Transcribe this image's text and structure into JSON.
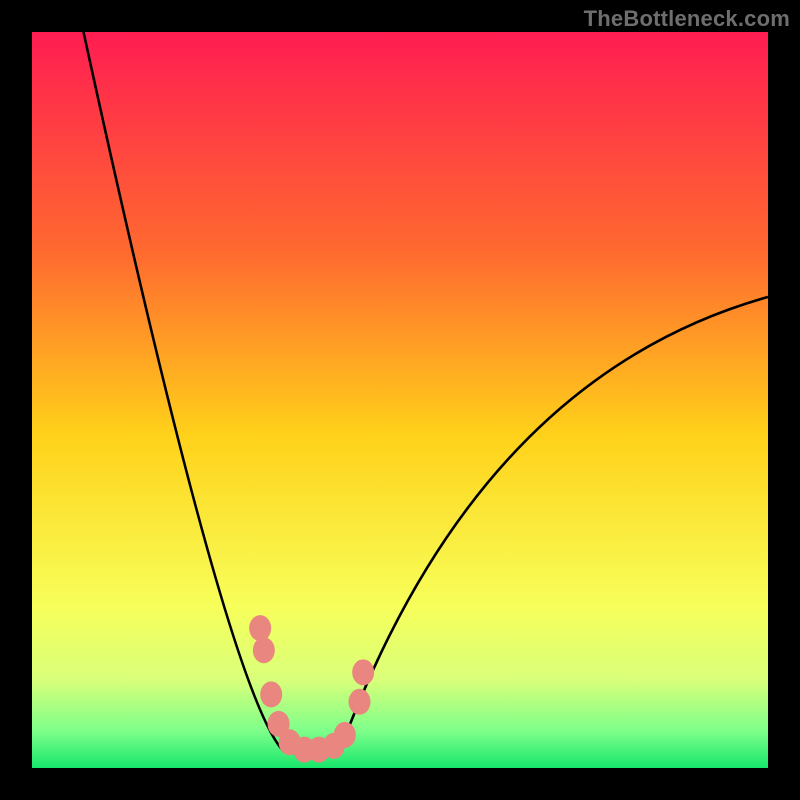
{
  "watermark": "TheBottleneck.com",
  "chart_data": {
    "type": "line",
    "title": "",
    "xlabel": "",
    "ylabel": "",
    "xlim": [
      0,
      100
    ],
    "ylim": [
      0,
      100
    ],
    "grid": false,
    "legend": false,
    "gradient": {
      "stops": [
        {
          "offset": 0.0,
          "color": "#ff1d52"
        },
        {
          "offset": 0.3,
          "color": "#ff6a2f"
        },
        {
          "offset": 0.55,
          "color": "#ffd21a"
        },
        {
          "offset": 0.78,
          "color": "#f7ff5a"
        },
        {
          "offset": 0.88,
          "color": "#d9ff7a"
        },
        {
          "offset": 0.95,
          "color": "#7dff8a"
        },
        {
          "offset": 1.0,
          "color": "#17e66c"
        }
      ]
    },
    "green_band": {
      "y_top": 93,
      "y_bottom": 100
    },
    "curve": {
      "type": "v-shape",
      "vertex_x": 38,
      "vertex_y": 98,
      "left_start": {
        "x": 7,
        "y": 0
      },
      "right_end": {
        "x": 100,
        "y": 36
      },
      "note": "Values estimated from pixels; y is mismatch-percentage (0 at top, 100 at bottom of plot)."
    },
    "markers": {
      "color": "#e8867f",
      "points": [
        {
          "x": 31,
          "y": 81
        },
        {
          "x": 31.5,
          "y": 84
        },
        {
          "x": 32.5,
          "y": 90
        },
        {
          "x": 33.5,
          "y": 94
        },
        {
          "x": 35,
          "y": 96.5
        },
        {
          "x": 37,
          "y": 97.5
        },
        {
          "x": 39,
          "y": 97.5
        },
        {
          "x": 41,
          "y": 97
        },
        {
          "x": 42.5,
          "y": 95.5
        },
        {
          "x": 44.5,
          "y": 91
        },
        {
          "x": 45,
          "y": 87
        }
      ]
    }
  }
}
